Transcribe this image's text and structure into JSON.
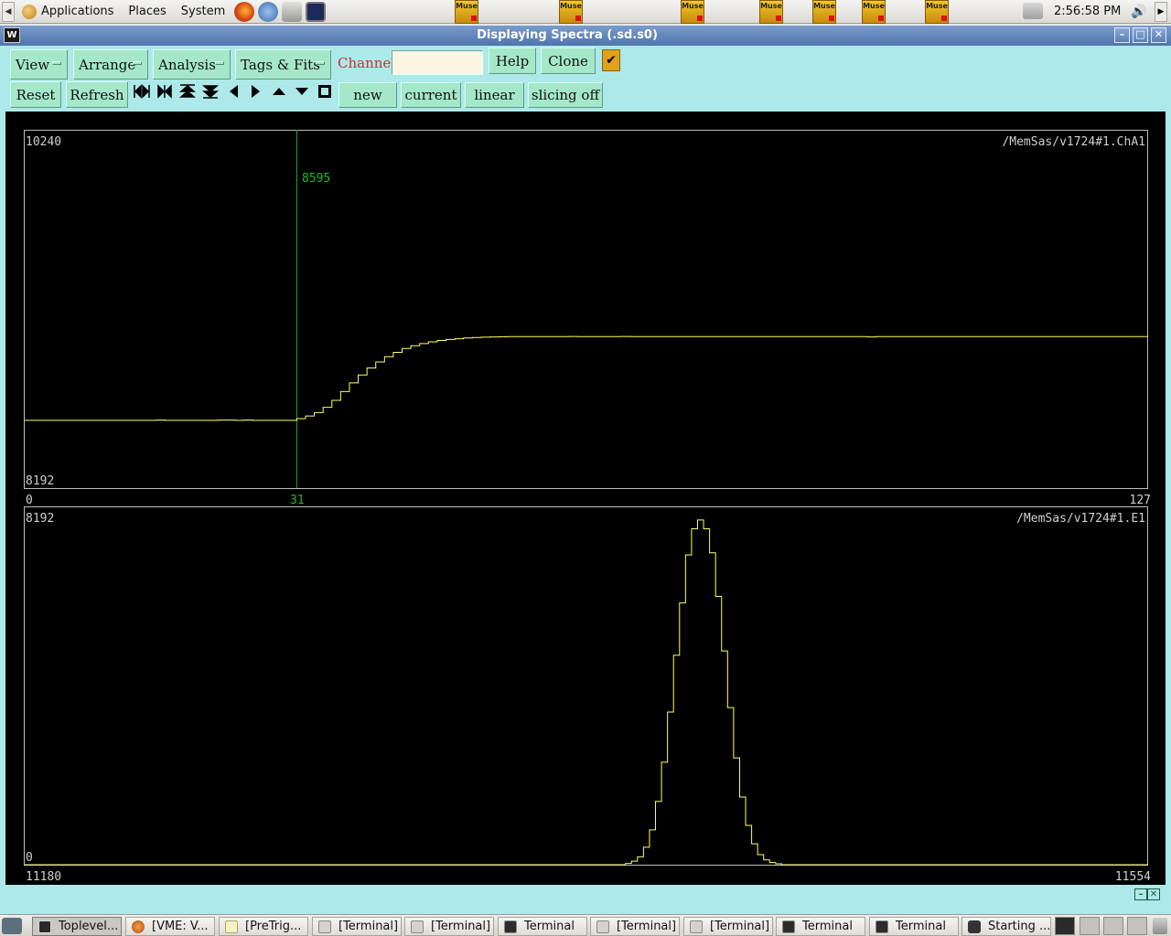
{
  "top_panel": {
    "menus": [
      "Applications",
      "Places",
      "System"
    ],
    "clock": "2:56:58 PM",
    "muse_icon_label": "Muse"
  },
  "window": {
    "title": "Displaying Spectra (.sd.s0)",
    "app_icon_glyph": "W",
    "minimize": "–",
    "maximize": "□",
    "close": "✕"
  },
  "toolbar": {
    "menus": [
      "View",
      "Arrange",
      "Analysis",
      "Tags & Fits"
    ],
    "channel_label": "Channel:",
    "channel_value": "",
    "help": "Help",
    "clone": "Clone",
    "check": "✔",
    "reset": "Reset",
    "refresh": "Refresh",
    "mode_buttons": [
      "new",
      "current",
      "linear",
      "slicing off"
    ]
  },
  "plots": {
    "top": {
      "name": "/MemSas/v1724#1.ChA1",
      "y_max": "10240",
      "y_min": "8192",
      "x_min": "0",
      "x_max": "127",
      "cursor_x": "31",
      "cursor_value": "8595"
    },
    "bottom": {
      "name": "/MemSas/v1724#1.E1",
      "y_max": "8192",
      "y_min": "0",
      "x_min": "11180",
      "x_max": "11554"
    }
  },
  "colors": {
    "trace": "#ffff66",
    "cursor": "#22aa22",
    "background": "#aee9ea",
    "button": "#a4e8c9"
  },
  "taskbar": {
    "tasks": [
      "Toplevel...",
      "[VME: V...",
      "[PreTrig...",
      "[Terminal]",
      "[Terminal]",
      "Terminal",
      "[Terminal]",
      "[Terminal]",
      "Terminal",
      "Terminal",
      "Starting ..."
    ]
  },
  "chart_data": [
    {
      "type": "line",
      "style": "step",
      "title": "/MemSas/v1724#1.ChA1",
      "xlim": [
        0,
        127
      ],
      "ylim": [
        8192,
        10240
      ],
      "cursor": {
        "x": 31,
        "y": 8595
      },
      "x": [
        0,
        1,
        2,
        3,
        4,
        5,
        6,
        7,
        8,
        9,
        10,
        11,
        12,
        13,
        14,
        15,
        16,
        17,
        18,
        19,
        20,
        21,
        22,
        23,
        24,
        25,
        26,
        27,
        28,
        29,
        30,
        31,
        32,
        33,
        34,
        35,
        36,
        37,
        38,
        39,
        40,
        41,
        42,
        43,
        44,
        45,
        46,
        47,
        48,
        49,
        50,
        51,
        52,
        53,
        54,
        55,
        56,
        57,
        58,
        59,
        60,
        61,
        62,
        63,
        64,
        65,
        66,
        67,
        68,
        69,
        70,
        71,
        72,
        73,
        74,
        75,
        76,
        77,
        78,
        79,
        80,
        81,
        82,
        83,
        84,
        85,
        86,
        87,
        88,
        89,
        90,
        91,
        92,
        93,
        94,
        95,
        96,
        97,
        98,
        99,
        100,
        101,
        102,
        103,
        104,
        105,
        106,
        107,
        108,
        109,
        110,
        111,
        112,
        113,
        114,
        115,
        116,
        117,
        118,
        119,
        120,
        121,
        122,
        123,
        124,
        125,
        126,
        127
      ],
      "values": [
        8580,
        8580,
        8580,
        8580,
        8580,
        8580,
        8580,
        8580,
        8580,
        8580,
        8580,
        8580,
        8580,
        8580,
        8580,
        8582,
        8580,
        8580,
        8580,
        8580,
        8580,
        8580,
        8582,
        8582,
        8580,
        8582,
        8580,
        8580,
        8580,
        8580,
        8580,
        8590,
        8605,
        8625,
        8655,
        8695,
        8745,
        8795,
        8840,
        8880,
        8915,
        8945,
        8970,
        8992,
        9008,
        9020,
        9030,
        9038,
        9044,
        9048,
        9052,
        9055,
        9057,
        9058,
        9059,
        9060,
        9060,
        9060,
        9060,
        9060,
        9060,
        9060,
        9061,
        9060,
        9060,
        9060,
        9060,
        9060,
        9061,
        9060,
        9060,
        9060,
        9060,
        9060,
        9060,
        9060,
        9060,
        9060,
        9060,
        9060,
        9060,
        9060,
        9060,
        9060,
        9060,
        9060,
        9060,
        9060,
        9060,
        9060,
        9060,
        9060,
        9060,
        9060,
        9060,
        9060,
        9058,
        9060,
        9060,
        9060,
        9060,
        9060,
        9060,
        9060,
        9060,
        9060,
        9060,
        9060,
        9060,
        9060,
        9060,
        9060,
        9060,
        9060,
        9060,
        9060,
        9060,
        9060,
        9060,
        9060,
        9060,
        9060,
        9060,
        9060,
        9060,
        9060,
        9060,
        9060
      ]
    },
    {
      "type": "line",
      "style": "step",
      "title": "/MemSas/v1724#1.E1",
      "xlim": [
        11180,
        11554
      ],
      "ylim": [
        0,
        8192
      ],
      "x": [
        11380,
        11382,
        11384,
        11386,
        11388,
        11390,
        11392,
        11394,
        11396,
        11398,
        11400,
        11402,
        11404,
        11406,
        11408,
        11410,
        11412,
        11414,
        11416,
        11418,
        11420,
        11422,
        11424,
        11426,
        11428,
        11430,
        11432
      ],
      "values": [
        30,
        80,
        180,
        400,
        800,
        1450,
        2350,
        3500,
        4800,
        6000,
        7100,
        7700,
        7900,
        7700,
        7150,
        6150,
        4900,
        3600,
        2450,
        1550,
        900,
        480,
        230,
        110,
        50,
        20,
        0
      ]
    }
  ]
}
